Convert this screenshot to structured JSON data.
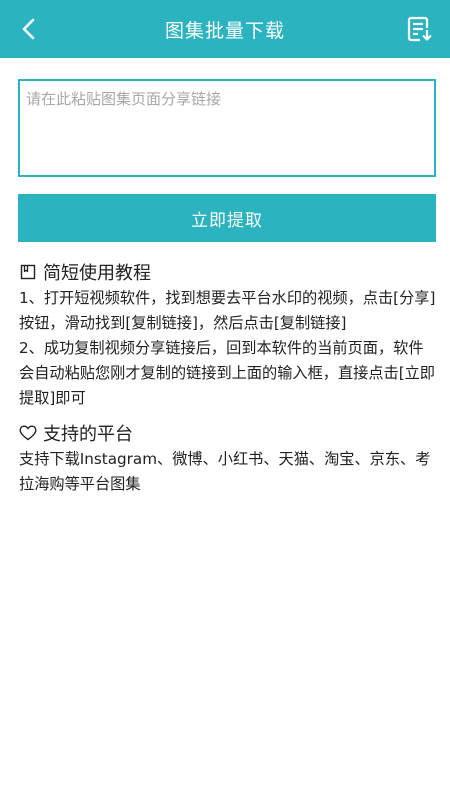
{
  "header": {
    "title": "图集批量下载",
    "bg_color": "#2bb3c0",
    "back_icon": "chevron-left-icon",
    "download_icon": "download-list-icon"
  },
  "input": {
    "placeholder": "请在此粘贴图集页面分享链接",
    "value": ""
  },
  "extract_button": {
    "label": "立即提取"
  },
  "tutorial": {
    "title": "简短使用教程",
    "icon": "bookmark-icon",
    "step1": "1、打开短视频软件，找到想要去平台水印的视频，点击[分享]按钮，滑动找到[复制链接]，然后点击[复制链接]",
    "step2": "2、成功复制视频分享链接后，回到本软件的当前页面，软件会自动粘贴您刚才复制的链接到上面的输入框，直接点击[立即提取]即可"
  },
  "platforms": {
    "title": "支持的平台",
    "icon": "heart-icon",
    "text": "支持下载Instagram、微博、小红书、天猫、淘宝、京东、考拉海购等平台图集"
  }
}
